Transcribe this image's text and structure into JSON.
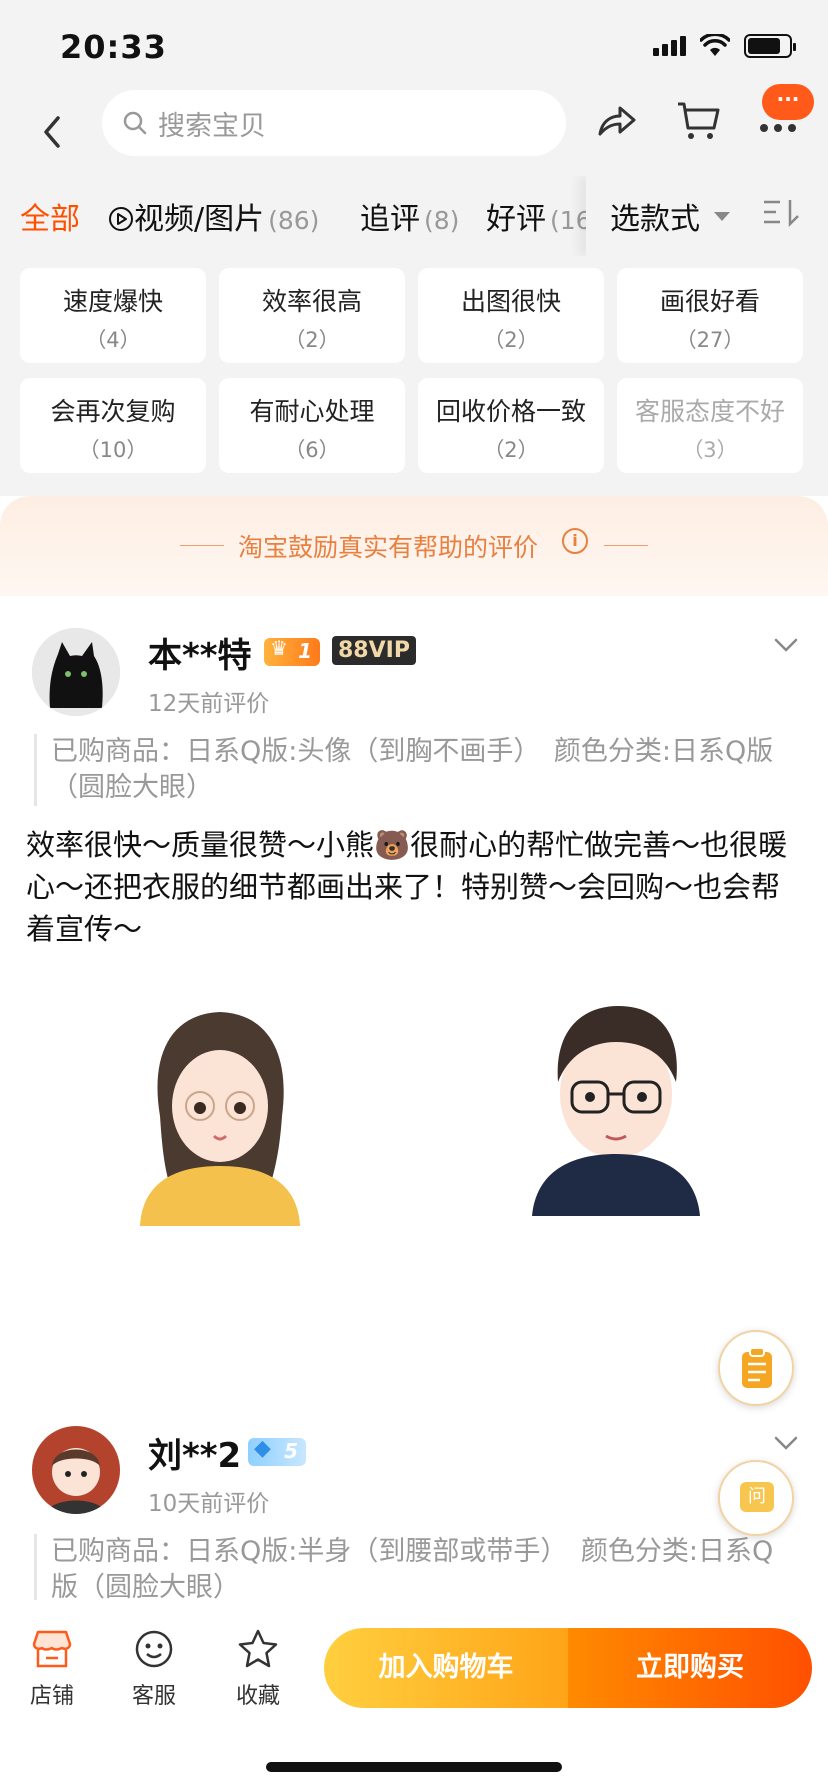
{
  "status_bar": {
    "time": "20:33"
  },
  "nav": {
    "search_placeholder": "搜索宝贝",
    "badge": "···"
  },
  "tabs": [
    {
      "label": "全部",
      "count": "",
      "active": true
    },
    {
      "label": "视频/图片",
      "count": "(86)"
    },
    {
      "label": "追评",
      "count": "(8)"
    },
    {
      "label": "好评",
      "count": "(16"
    }
  ],
  "filter": {
    "label": "选款式"
  },
  "tags": [
    {
      "label": "速度爆快",
      "count": "（4）"
    },
    {
      "label": "效率很高",
      "count": "（2）"
    },
    {
      "label": "出图很快",
      "count": "（2）"
    },
    {
      "label": "画很好看",
      "count": "（27）"
    },
    {
      "label": "会再次复购",
      "count": "（10）"
    },
    {
      "label": "有耐心处理",
      "count": "（6）"
    },
    {
      "label": "回收价格一致",
      "count": "（2）"
    },
    {
      "label": "客服态度不好",
      "count": "（3）"
    }
  ],
  "banner": {
    "text": "淘宝鼓励真实有帮助的评价"
  },
  "reviews": [
    {
      "user": "本**特",
      "level": "1",
      "vip": "88VIP",
      "when": "12天前评价",
      "item": "已购商品：日系Q版:头像（到胸不画手）　颜色分类:日系Q版（圆脸大眼）",
      "text": "效率很快～质量很赞～小熊🐻很耐心的帮忙做完善～也很暖心～还把衣服的细节都画出来了！特别赞～会回购～也会帮着宣传～"
    },
    {
      "user": "刘**2",
      "level": "5",
      "when": "10天前评价",
      "item": "已购商品：日系Q版:半身（到腰部或带手）　颜色分类:日系Q版（圆脸大眼）"
    }
  ],
  "bottom_bar": {
    "shop": "店铺",
    "service": "客服",
    "favorite": "收藏",
    "add_to_cart": "加入购物车",
    "buy_now": "立即购买"
  },
  "fab": {
    "ask": "问"
  }
}
